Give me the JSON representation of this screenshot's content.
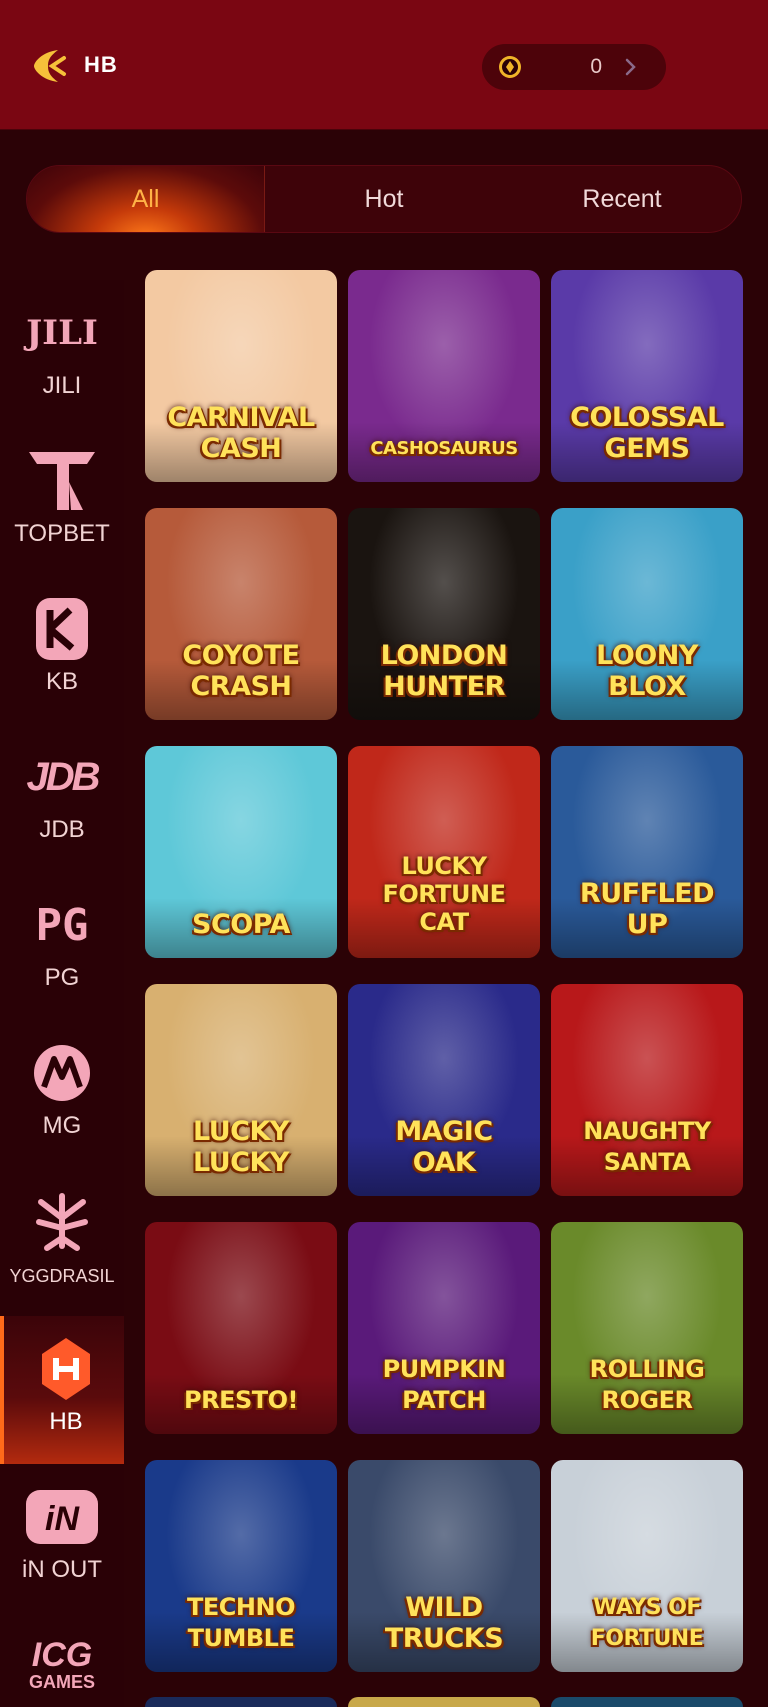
{
  "header": {
    "title": "HB",
    "balance": "0"
  },
  "tabs": [
    {
      "label": "All",
      "active": true
    },
    {
      "label": "Hot",
      "active": false
    },
    {
      "label": "Recent",
      "active": false
    }
  ],
  "providers": [
    {
      "label": "JILI",
      "logo": "JILI"
    },
    {
      "label": "TOPBET",
      "logo": "T"
    },
    {
      "label": "KB",
      "logo": "KB"
    },
    {
      "label": "JDB",
      "logo": "JDB"
    },
    {
      "label": "PG",
      "logo": "PG"
    },
    {
      "label": "MG",
      "logo": "MG"
    },
    {
      "label": "YGGDRASIL",
      "logo": "YGG"
    },
    {
      "label": "HB",
      "logo": "H",
      "active": true
    },
    {
      "label": "iN OUT",
      "logo": "iN"
    },
    {
      "label": "",
      "logo": "ICG GAMES"
    }
  ],
  "games": [
    {
      "title": "CARNIVAL\nCASH",
      "bg": "#f3c9a2"
    },
    {
      "title": "CASHOSAURUS",
      "bg": "#7a2a8e"
    },
    {
      "title": "COLOSSAL\nGEMS",
      "bg": "#5a3aa8"
    },
    {
      "title": "COYOTE\nCRASH",
      "bg": "#b65a3a"
    },
    {
      "title": "LONDON\nHUNTER",
      "bg": "#1a1410"
    },
    {
      "title": "LOONY\nBLOX",
      "bg": "#3aa0c8"
    },
    {
      "title": "SCOPA",
      "bg": "#5ec8d8"
    },
    {
      "title": "LUCKY\nFORTUNE\nCAT",
      "bg": "#c0281a"
    },
    {
      "title": "RUFFLED\nUP",
      "bg": "#2a5a9a"
    },
    {
      "title": "LUCKY\nLUCKY",
      "bg": "#d8b070"
    },
    {
      "title": "MAGIC\nOAK",
      "bg": "#2a2a8a"
    },
    {
      "title": "NAUGHTY\nSANTA",
      "bg": "#b8181a"
    },
    {
      "title": "PRESTO!",
      "bg": "#7a0c14"
    },
    {
      "title": "PUMPKIN\nPATCH",
      "bg": "#5a1a7a"
    },
    {
      "title": "ROLLING\nROGER",
      "bg": "#6a8a2a"
    },
    {
      "title": "TECHNO\nTUMBLE",
      "bg": "#1a3a8a"
    },
    {
      "title": "WILD\nTRUCKS",
      "bg": "#3a4a6a"
    },
    {
      "title": "WAYS OF\nFORTUNE",
      "bg": "#c8d0d8"
    }
  ],
  "colors": {
    "accent": "#ff9a2a",
    "header_bg": "#7a0612",
    "page_bg": "#2b0206"
  }
}
